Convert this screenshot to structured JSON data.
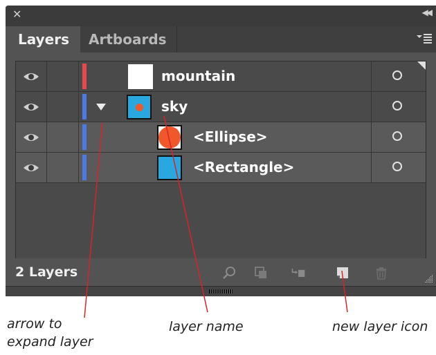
{
  "titlebar": {
    "close_icon": "close-icon",
    "collapse_icon": "collapse-panel-icon"
  },
  "tabs": [
    {
      "label": "Layers",
      "active": true
    },
    {
      "label": "Artboards",
      "active": false
    }
  ],
  "layers": [
    {
      "name": "mountain",
      "color": "#e9494c",
      "visible": true,
      "expandable": false,
      "selected": false,
      "indent": 0,
      "thumb": "white-square"
    },
    {
      "name": "sky",
      "color": "#4c7be8",
      "visible": true,
      "expandable": true,
      "expanded": true,
      "selected": false,
      "indent": 0,
      "thumb": "blue-with-orange-dot"
    },
    {
      "name": "<Ellipse>",
      "color": "#4c7be8",
      "visible": true,
      "expandable": false,
      "selected": true,
      "indent": 1,
      "thumb": "orange-circle"
    },
    {
      "name": "<Rectangle>",
      "color": "#4c7be8",
      "visible": true,
      "expandable": false,
      "selected": true,
      "indent": 1,
      "thumb": "blue-square"
    }
  ],
  "footer": {
    "count_label": "2 Layers",
    "icons": [
      "locate-object-icon",
      "make-clipping-mask-icon",
      "create-sublayer-icon",
      "new-layer-icon",
      "trash-icon"
    ]
  },
  "annotations": {
    "arrow": "arrow to\nexpand layer",
    "layer_name": "layer name",
    "new_layer": "new layer icon"
  },
  "colors": {
    "panel": "#535353",
    "red_layer": "#e9494c",
    "blue_layer": "#4c7be8",
    "sky_blue": "#29a8e0",
    "orange": "#f0572a"
  }
}
